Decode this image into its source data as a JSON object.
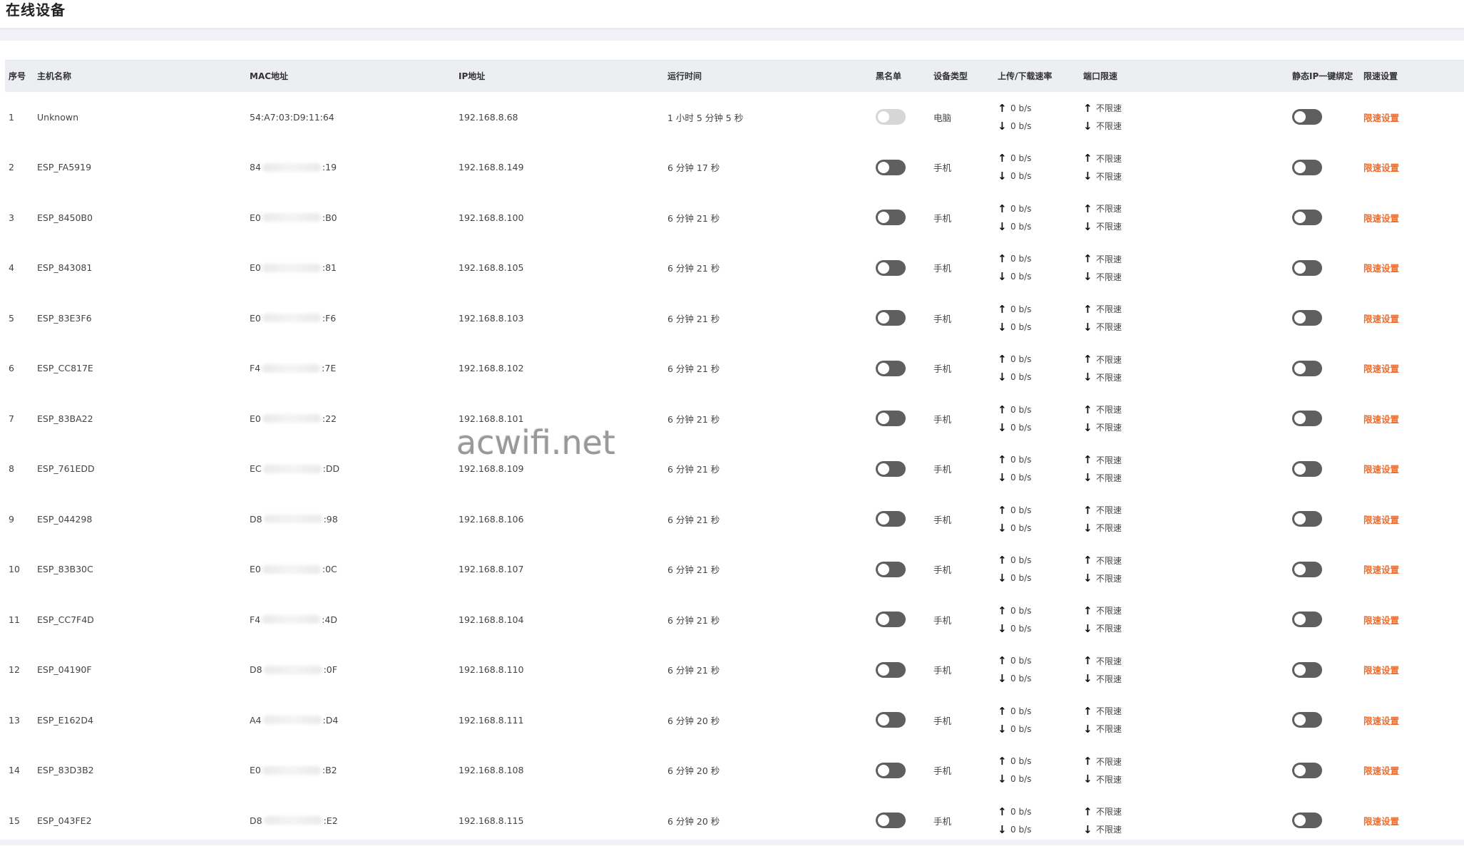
{
  "page": {
    "title": "在线设备"
  },
  "table": {
    "headers": {
      "index": "序号",
      "hostname": "主机名称",
      "mac": "MAC地址",
      "ip": "IP地址",
      "uptime": "运行时间",
      "blacklist": "黑名单",
      "device_type": "设备类型",
      "rate": "上传/下载速率",
      "port_limit": "端口限速",
      "static_ip": "静态IP一键绑定",
      "limit_settings": "限速设置"
    },
    "rows": [
      {
        "index": "1",
        "hostname": "Unknown",
        "mac_prefix": "54:A7:03:D9:11:64",
        "mac_suffix": "",
        "mac_blurred": false,
        "ip": "192.168.8.68",
        "uptime": "1 小时 5 分钟 5 秒",
        "blacklist": "off-disabled",
        "device_type": "电脑",
        "up_rate": "0 b/s",
        "down_rate": "0 b/s",
        "port_up": "不限速",
        "port_down": "不限速",
        "static_ip": "off",
        "limit_label": "限速设置"
      },
      {
        "index": "2",
        "hostname": "ESP_FA5919",
        "mac_prefix": "84",
        "mac_suffix": ":19",
        "mac_blurred": true,
        "ip": "192.168.8.149",
        "uptime": "6 分钟 17 秒",
        "blacklist": "off",
        "device_type": "手机",
        "up_rate": "0 b/s",
        "down_rate": "0 b/s",
        "port_up": "不限速",
        "port_down": "不限速",
        "static_ip": "off",
        "limit_label": "限速设置"
      },
      {
        "index": "3",
        "hostname": "ESP_8450B0",
        "mac_prefix": "E0",
        "mac_suffix": ":B0",
        "mac_blurred": true,
        "ip": "192.168.8.100",
        "uptime": "6 分钟 21 秒",
        "blacklist": "off",
        "device_type": "手机",
        "up_rate": "0 b/s",
        "down_rate": "0 b/s",
        "port_up": "不限速",
        "port_down": "不限速",
        "static_ip": "off",
        "limit_label": "限速设置"
      },
      {
        "index": "4",
        "hostname": "ESP_843081",
        "mac_prefix": "E0",
        "mac_suffix": ":81",
        "mac_blurred": true,
        "ip": "192.168.8.105",
        "uptime": "6 分钟 21 秒",
        "blacklist": "off",
        "device_type": "手机",
        "up_rate": "0 b/s",
        "down_rate": "0 b/s",
        "port_up": "不限速",
        "port_down": "不限速",
        "static_ip": "off",
        "limit_label": "限速设置"
      },
      {
        "index": "5",
        "hostname": "ESP_83E3F6",
        "mac_prefix": "E0",
        "mac_suffix": ":F6",
        "mac_blurred": true,
        "ip": "192.168.8.103",
        "uptime": "6 分钟 21 秒",
        "blacklist": "off",
        "device_type": "手机",
        "up_rate": "0 b/s",
        "down_rate": "0 b/s",
        "port_up": "不限速",
        "port_down": "不限速",
        "static_ip": "off",
        "limit_label": "限速设置"
      },
      {
        "index": "6",
        "hostname": "ESP_CC817E",
        "mac_prefix": "F4",
        "mac_suffix": ":7E",
        "mac_blurred": true,
        "ip": "192.168.8.102",
        "uptime": "6 分钟 21 秒",
        "blacklist": "off",
        "device_type": "手机",
        "up_rate": "0 b/s",
        "down_rate": "0 b/s",
        "port_up": "不限速",
        "port_down": "不限速",
        "static_ip": "off",
        "limit_label": "限速设置"
      },
      {
        "index": "7",
        "hostname": "ESP_83BA22",
        "mac_prefix": "E0",
        "mac_suffix": ":22",
        "mac_blurred": true,
        "ip": "192.168.8.101",
        "uptime": "6 分钟 21 秒",
        "blacklist": "off",
        "device_type": "手机",
        "up_rate": "0 b/s",
        "down_rate": "0 b/s",
        "port_up": "不限速",
        "port_down": "不限速",
        "static_ip": "off",
        "limit_label": "限速设置"
      },
      {
        "index": "8",
        "hostname": "ESP_761EDD",
        "mac_prefix": "EC",
        "mac_suffix": ":DD",
        "mac_blurred": true,
        "ip": "192.168.8.109",
        "uptime": "6 分钟 21 秒",
        "blacklist": "off",
        "device_type": "手机",
        "up_rate": "0 b/s",
        "down_rate": "0 b/s",
        "port_up": "不限速",
        "port_down": "不限速",
        "static_ip": "off",
        "limit_label": "限速设置"
      },
      {
        "index": "9",
        "hostname": "ESP_044298",
        "mac_prefix": "D8",
        "mac_suffix": ":98",
        "mac_blurred": true,
        "ip": "192.168.8.106",
        "uptime": "6 分钟 21 秒",
        "blacklist": "off",
        "device_type": "手机",
        "up_rate": "0 b/s",
        "down_rate": "0 b/s",
        "port_up": "不限速",
        "port_down": "不限速",
        "static_ip": "off",
        "limit_label": "限速设置"
      },
      {
        "index": "10",
        "hostname": "ESP_83B30C",
        "mac_prefix": "E0",
        "mac_suffix": ":0C",
        "mac_blurred": true,
        "ip": "192.168.8.107",
        "uptime": "6 分钟 21 秒",
        "blacklist": "off",
        "device_type": "手机",
        "up_rate": "0 b/s",
        "down_rate": "0 b/s",
        "port_up": "不限速",
        "port_down": "不限速",
        "static_ip": "off",
        "limit_label": "限速设置"
      },
      {
        "index": "11",
        "hostname": "ESP_CC7F4D",
        "mac_prefix": "F4",
        "mac_suffix": ":4D",
        "mac_blurred": true,
        "ip": "192.168.8.104",
        "uptime": "6 分钟 21 秒",
        "blacklist": "off",
        "device_type": "手机",
        "up_rate": "0 b/s",
        "down_rate": "0 b/s",
        "port_up": "不限速",
        "port_down": "不限速",
        "static_ip": "off",
        "limit_label": "限速设置"
      },
      {
        "index": "12",
        "hostname": "ESP_04190F",
        "mac_prefix": "D8",
        "mac_suffix": ":0F",
        "mac_blurred": true,
        "ip": "192.168.8.110",
        "uptime": "6 分钟 21 秒",
        "blacklist": "off",
        "device_type": "手机",
        "up_rate": "0 b/s",
        "down_rate": "0 b/s",
        "port_up": "不限速",
        "port_down": "不限速",
        "static_ip": "off",
        "limit_label": "限速设置"
      },
      {
        "index": "13",
        "hostname": "ESP_E162D4",
        "mac_prefix": "A4",
        "mac_suffix": ":D4",
        "mac_blurred": true,
        "ip": "192.168.8.111",
        "uptime": "6 分钟 20 秒",
        "blacklist": "off",
        "device_type": "手机",
        "up_rate": "0 b/s",
        "down_rate": "0 b/s",
        "port_up": "不限速",
        "port_down": "不限速",
        "static_ip": "off",
        "limit_label": "限速设置"
      },
      {
        "index": "14",
        "hostname": "ESP_83D3B2",
        "mac_prefix": "E0",
        "mac_suffix": ":B2",
        "mac_blurred": true,
        "ip": "192.168.8.108",
        "uptime": "6 分钟 20 秒",
        "blacklist": "off",
        "device_type": "手机",
        "up_rate": "0 b/s",
        "down_rate": "0 b/s",
        "port_up": "不限速",
        "port_down": "不限速",
        "static_ip": "off",
        "limit_label": "限速设置"
      },
      {
        "index": "15",
        "hostname": "ESP_043FE2",
        "mac_prefix": "D8",
        "mac_suffix": ":E2",
        "mac_blurred": true,
        "ip": "192.168.8.115",
        "uptime": "6 分钟 20 秒",
        "blacklist": "off",
        "device_type": "手机",
        "up_rate": "0 b/s",
        "down_rate": "0 b/s",
        "port_up": "不限速",
        "port_down": "不限速",
        "static_ip": "off",
        "limit_label": "限速设置"
      }
    ]
  },
  "icons": {
    "up": "arrow-up-icon",
    "down": "arrow-down-icon"
  },
  "watermark": "acwifi.net",
  "colors": {
    "link": "#ef6b2a",
    "toggle_off": "#5f5f5f",
    "toggle_disabled": "#d6d6d6",
    "header_bg": "#eceef2"
  }
}
